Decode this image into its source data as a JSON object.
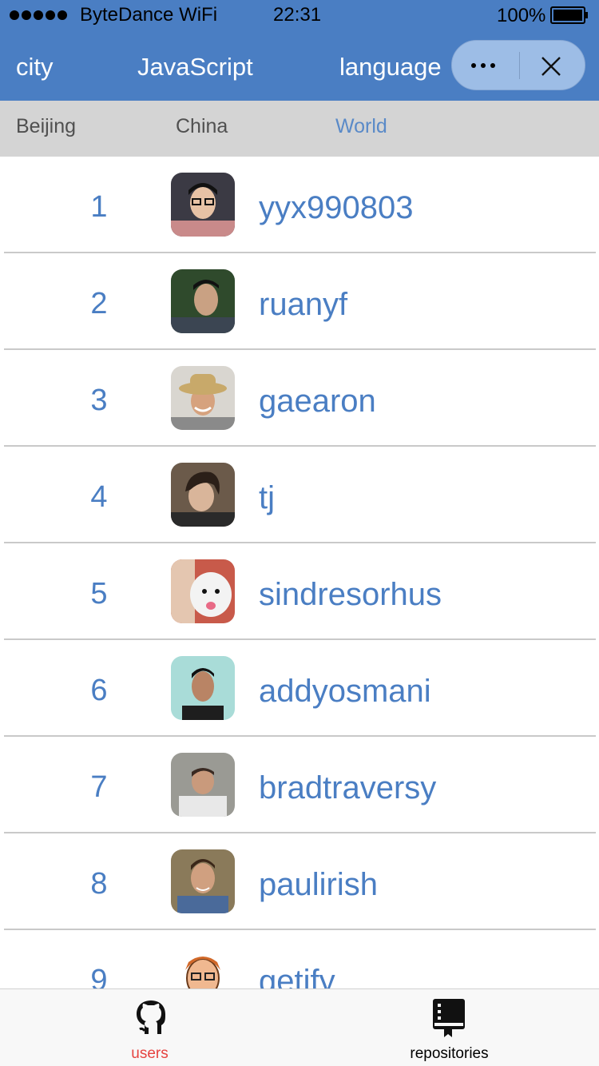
{
  "status_bar": {
    "carrier": "ByteDance WiFi",
    "time": "22:31",
    "battery": "100%"
  },
  "nav": {
    "city": "city",
    "language_value": "JavaScript",
    "language": "language"
  },
  "subtabs": [
    {
      "label": "Beijing",
      "active": false
    },
    {
      "label": "China",
      "active": false
    },
    {
      "label": "World",
      "active": true
    }
  ],
  "users": [
    {
      "rank": "1",
      "name": "yyx990803"
    },
    {
      "rank": "2",
      "name": "ruanyf"
    },
    {
      "rank": "3",
      "name": "gaearon"
    },
    {
      "rank": "4",
      "name": "tj"
    },
    {
      "rank": "5",
      "name": "sindresorhus"
    },
    {
      "rank": "6",
      "name": "addyosmani"
    },
    {
      "rank": "7",
      "name": "bradtraversy"
    },
    {
      "rank": "8",
      "name": "paulirish"
    },
    {
      "rank": "9",
      "name": "getify"
    }
  ],
  "tabbar": {
    "users_label": "users",
    "repos_label": "repositories"
  },
  "colors": {
    "primary": "#4a7ec3",
    "active_tab": "#e64340",
    "subtab_bg": "#d4d4d4"
  }
}
